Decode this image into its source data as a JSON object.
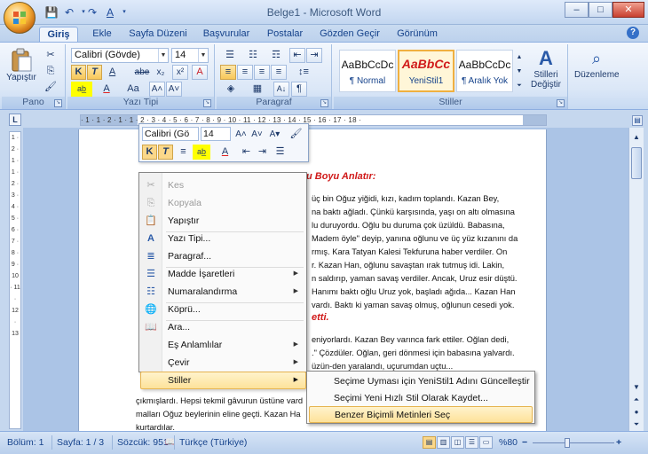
{
  "window": {
    "title": "Belge1 - Microsoft Word",
    "minimize": "–",
    "maximize": "□",
    "close": "✕"
  },
  "qat": {
    "save_icon": "save-icon",
    "undo_icon": "undo-icon",
    "redo_icon": "redo-icon"
  },
  "tabs": [
    {
      "label": "Giriş",
      "active": true
    },
    {
      "label": "Ekle"
    },
    {
      "label": "Sayfa Düzeni"
    },
    {
      "label": "Başvurular"
    },
    {
      "label": "Postalar"
    },
    {
      "label": "Gözden Geçir"
    },
    {
      "label": "Görünüm"
    }
  ],
  "ribbon": {
    "clipboard": {
      "label": "Pano",
      "paste": "Yapıştır"
    },
    "font": {
      "label": "Yazı Tipi",
      "family": "Calibri (Gövde)",
      "size": "14",
      "bold": "K",
      "italic": "T",
      "underline": "A",
      "strike": "abe",
      "sub": "x₂",
      "sup": "x²",
      "grow": "A˄",
      "shrink": "A˅",
      "case": "Aa",
      "clear": "A"
    },
    "paragraph": {
      "label": "Paragraf",
      "pilcrow": "¶"
    },
    "styles": {
      "label": "Stiller",
      "items": [
        {
          "sample": "AaBbCcDc",
          "name": "¶ Normal"
        },
        {
          "sample": "AaBbCc",
          "name": "YeniStil1"
        },
        {
          "sample": "AaBbCcDc",
          "name": "¶ Aralık Yok"
        }
      ],
      "change": "Stilleri Değiştir"
    },
    "editing": {
      "label": "Düzenleme"
    }
  },
  "ruler": {
    "numbers": "· 1 · 1 · 2 · 1 · 1 · 2 · 3 · 4 · 5 · 6 · 7 · 8 · 9 · 10 · 11 · 12 · 13 · 14 · 15 · 16 · 17 · 18 ·",
    "vnumbers": "1 · 2 · 1 · 1 · 2 · 3 · 4 · 5 · 6 · 7 · 8 · 9 · 10 · 11 · 12 · 13"
  },
  "document": {
    "heading": "... Olduğu Boyu Anlatır:",
    "lines": [
      "üç bin Oğuz yiğidi, kızı, kadım toplandı. Kazan Bey,",
      "na baktı ağladı. Çünkü karşısında, yaşı on altı olmasına",
      "lu duruyordu. Oğlu bu duruma çok üzüldü. Babasına,",
      "Madem öyle\" deyip, yanına oğlunu ve üç yüz kızanını da",
      "rmış. Kara Tatyan Kalesi Tekfuruna haber verdiler. On",
      "r. Kazan Han, oğlunu savaştan ırak tutmuş idi. Lakin,",
      "n saldırıp, yaman savaş verdiler. Ancak, Uruz esir düştü.",
      "Hanımı baktı oğlu Uruz yok, başladı ağıda... Kazan Han",
      "vardı. Baktı ki yaman savaş olmuş, oğlunun cesedi yok."
    ],
    "heading2": "etti.",
    "lines2": [
      "eniyorlardı. Kazan Bey varınca fark ettiler. Oğlan dedi,",
      ".\" Çözdüler. Oğlan, geri dönmesi için babasına yalvardı.",
      "üzün-den yaralandı, uçurumdan uçtu..."
    ],
    "lines3": [
      "çıkmışlardı. Hepsi tekmil gâvurun üstüne vard",
      "malları Oğuz beylerinin eline geçti. Kazan Ha",
      "kurtardılar."
    ]
  },
  "mini_toolbar": {
    "font": "Calibri (Gö",
    "size": "14",
    "bold": "K",
    "italic": "T",
    "align": "≡",
    "color": "A"
  },
  "context_menu": {
    "items": [
      {
        "label": "Kes",
        "icon": "scissors-icon",
        "disabled": true
      },
      {
        "label": "Kopyala",
        "icon": "copy-icon",
        "disabled": true
      },
      {
        "label": "Yapıştır",
        "icon": "paste-icon"
      },
      {
        "label": "Yazı Tipi...",
        "icon": "font-icon"
      },
      {
        "label": "Paragraf...",
        "icon": "paragraph-icon"
      },
      {
        "label": "Madde İşaretleri",
        "icon": "bullets-icon",
        "submenu": true
      },
      {
        "label": "Numaralandırma",
        "icon": "numbering-icon",
        "submenu": true
      },
      {
        "label": "Köprü...",
        "icon": "hyperlink-icon"
      },
      {
        "label": "Ara...",
        "icon": "research-icon"
      },
      {
        "label": "Eş Anlamlılar",
        "submenu": true
      },
      {
        "label": "Çevir",
        "submenu": true
      },
      {
        "label": "Stiller",
        "submenu": true,
        "highlighted": true
      }
    ]
  },
  "submenu": {
    "items": [
      {
        "label": "Seçime Uyması için YeniStil1 Adını Güncelleştir"
      },
      {
        "label": "Seçimi Yeni Hızlı Stil Olarak Kaydet..."
      },
      {
        "label": "Benzer Biçimli Metinleri Seç",
        "highlighted": true
      }
    ]
  },
  "statusbar": {
    "section": "Bölüm: 1",
    "page": "Sayfa: 1 / 3",
    "words": "Sözcük: 951",
    "language": "Türkçe (Türkiye)",
    "zoom": "%80",
    "zoom_value": 0.8
  },
  "colors": {
    "accent": "#15428b",
    "heading_red": "#d01a1a",
    "highlight": "#fde29a"
  }
}
